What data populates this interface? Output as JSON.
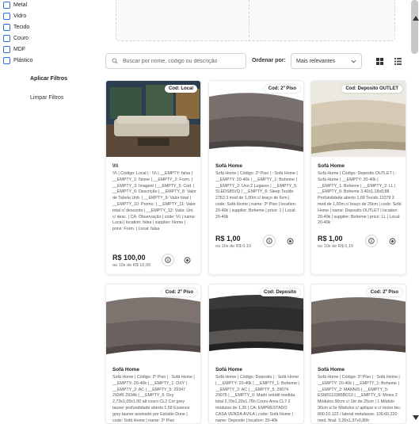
{
  "filters": {
    "materials": [
      "Metal",
      "Vidro",
      "Tecido",
      "Couro",
      "MDF",
      "Plástico"
    ],
    "apply_label": "Aplicar Filtros",
    "clear_label": "Limpar Filtros"
  },
  "toolbar": {
    "search_placeholder": "Buscar por nome, código ou descrição",
    "sort_label": "Ordenar por:",
    "sort_value": "Mais relevantes"
  },
  "cards": [
    {
      "badge": "Cod: Local",
      "title": "\\\\\\\\",
      "desc": "\\\\\\\\ | Código: Local | : \\\\\\\\ | __EMPTY: falsa | __EMPTY_1: Nome | __EMPTY_2: Form. | __EMPTY_3: Imagem | __EMPTY_5: Cod. | __EMPTY_6: Descrição | __EMPTY_8: Valor de Tabela Unit. | __EMPTY_9: Valor total | __EMPTY_10: Promo. | __EMPTY_11: Valor total c/ desconto | __EMPTY_12: Valor. Uni. c/ desc. | CA: Observação | code: \\\\\\\\ | name: Local | location: falsa | supplier: Nome | price: Form. | Local: falsa",
      "price": "R$ 100,00",
      "installments": "ou 10x de R$ 10,00"
    },
    {
      "badge": "Cod: 2º Piso",
      "title": "Sofá Home",
      "desc": "Sofá Home | Código: 2º Piso | : Sofá Home | __EMPTY: 20-40k | __EMPTY_1: Boheme | __EMPTY_2: Uno 2 Lugares | __EMPTY_5: SLEDS85VQ | __EMPTY_6: Sleep Tecido 2763 3 mod de 1,00m c/ braço de 6cm | code: Sofá Home | name: 2º Piso | location: 20-40k | supplier: Boheme | price: 1 | Local: 20-40k",
      "price": "R$ 1,00",
      "installments": "ou 10x de R$ 0,10"
    },
    {
      "badge": "Cod: Deposito OUTLET",
      "title": "Sofá Home",
      "desc": "Sofá Home | Código: Deposito OUTLET | : Sofá Home | __EMPTY: 20-40k | __EMPTY_1: Boheme | __EMPTY_2: LL | __EMPTY_6: Boheme 3,40x1,18x0,88 Profundidade aberto 1,68 Tecido 11078 3 mod de 1,00m c/ braço de 20cm | code: Sofá Home | name: Deposito OUTLET | location: 20-40k | supplier: Boheme | price: LL | Local: 20-40k",
      "price": "R$ 1,00",
      "installments": "ou 10x de R$ 0,10"
    },
    {
      "badge": "Cod: 2º Piso",
      "title": "Sofá Home",
      "desc": "Sofá Home | Código: 2º Piso | : Sofá Home | __EMPTY: 20-40k | __EMPTY_1: DXY | __EMPTY_2: AC | __EMPTY_5: 29347 29345 2934b | __EMPTY_6: Dxy 2,73x1,05x1,00 alt couro CL2 Cor grey tauner profundidade aberto 1,58 Essence grey tauner assinado por Estúdio Dune | code: Sofá Home | name: 2º Piso"
    },
    {
      "badge": "Cod: Deposito",
      "title": "Sofá Home",
      "desc": "Sofá Home | Código: Deposito | : Sofá Home | __EMPTY: 20-40k | __EMPTY_1: Boheme | __EMPTY_2: AC | __EMPTY_5: 29074 29075 | __EMPTY_6: Madri retrátil medida total 2,70x1,20x1,75h Couro Area CL7 2 módulos de 1,35 | CA: EMPRESTADO CASA VENDA ÁVILA | code: Sofá Home | name: Deposito | location: 20-40k"
    },
    {
      "badge": "Cod: 2º Piso",
      "title": "Sofá Home",
      "desc": "Sofá Home | Código: 2º Piso | : Sofá Home | __EMPTY: 20-40k | __EMPTY_1: Boheme | __EMPTY_2: MANNIS | __EMPTY_5: ESM0113385BD10 | __EMPTY_6: Mnios 2 Módulos 90cm c/ 1br de 25cm | 1 Módulo 90cm s/ br Módulos c/ aplique e c/ motor tec: 800.10.122 / lateral metalasse: 100.60.220 med. final: 3,20x1,37x0,80h"
    }
  ]
}
